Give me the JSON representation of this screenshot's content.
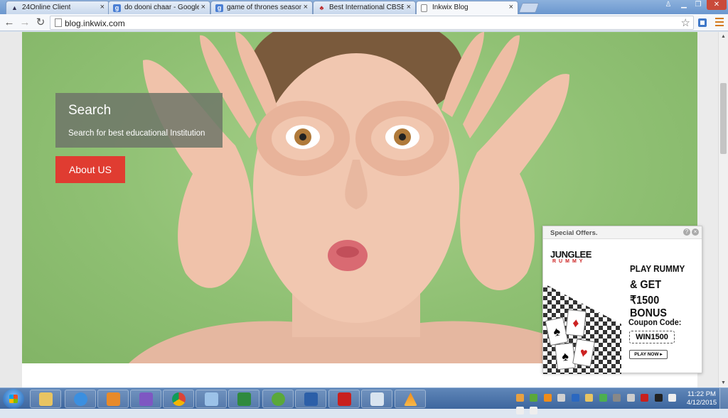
{
  "browser": {
    "tabs": [
      {
        "label": "24Online Client",
        "favicon": "app-icon"
      },
      {
        "label": "do dooni chaar - Google S",
        "favicon": "google-icon"
      },
      {
        "label": "game of thrones season 4",
        "favicon": "google-icon"
      },
      {
        "label": "Best International CBSE Sc",
        "favicon": "school-icon"
      },
      {
        "label": "Inkwix Blog",
        "favicon": "page-icon"
      }
    ],
    "tab_close_glyph": "×",
    "url": "blog.inkwix.com"
  },
  "page": {
    "search_card": {
      "title": "Search",
      "subtitle": "Search for best educational Institution"
    },
    "about_button": "About US"
  },
  "ad": {
    "header": "Special Offers.",
    "help_glyph": "?",
    "close_glyph": "×",
    "brand_line1": "JUNGLEE",
    "brand_line2": "RUMMY",
    "line1": "PLAY RUMMY",
    "line2": "& GET",
    "line3": "₹1500 BONUS",
    "coupon_label": "Coupon Code:",
    "coupon_code": "WIN1500",
    "play_button": "PLAY NOW ▸"
  },
  "taskbar": {
    "clock_time": "11:22 PM",
    "clock_date": "4/12/2015"
  },
  "colors": {
    "accent_red": "#e03c31",
    "hero_green": "#8fc073",
    "card_overlay": "#6e7668"
  }
}
